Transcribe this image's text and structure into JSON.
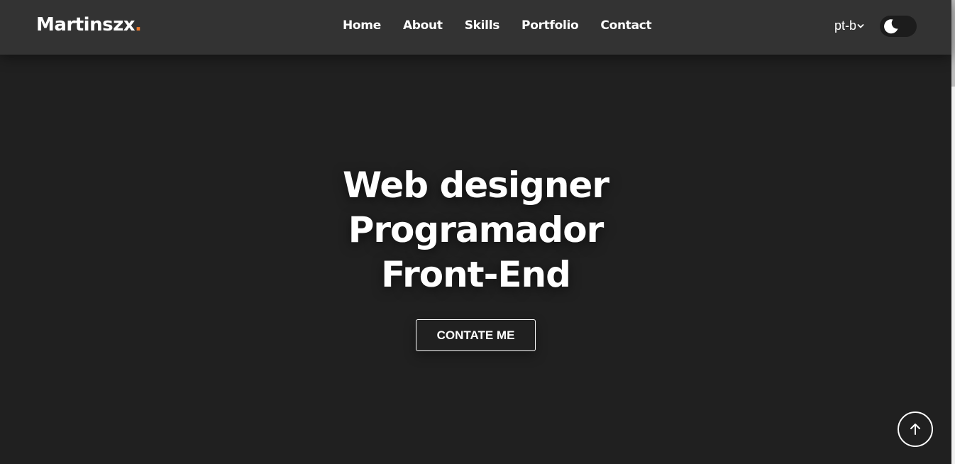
{
  "header": {
    "logo_text": "Martinszx",
    "logo_dot": ".",
    "nav": [
      "Home",
      "About",
      "Skills",
      "Portfolio",
      "Contact"
    ],
    "language": "pt-br",
    "theme_toggle_icon": "moon-icon"
  },
  "hero": {
    "lines": [
      "Web designer",
      "Programador",
      "Front-End"
    ],
    "cta_label": "CONTATE ME"
  },
  "scroll_top_icon": "arrow-up-icon",
  "colors": {
    "background": "#202020",
    "header": "#333333",
    "accent": "#f07a2a",
    "text": "#ffffff"
  }
}
